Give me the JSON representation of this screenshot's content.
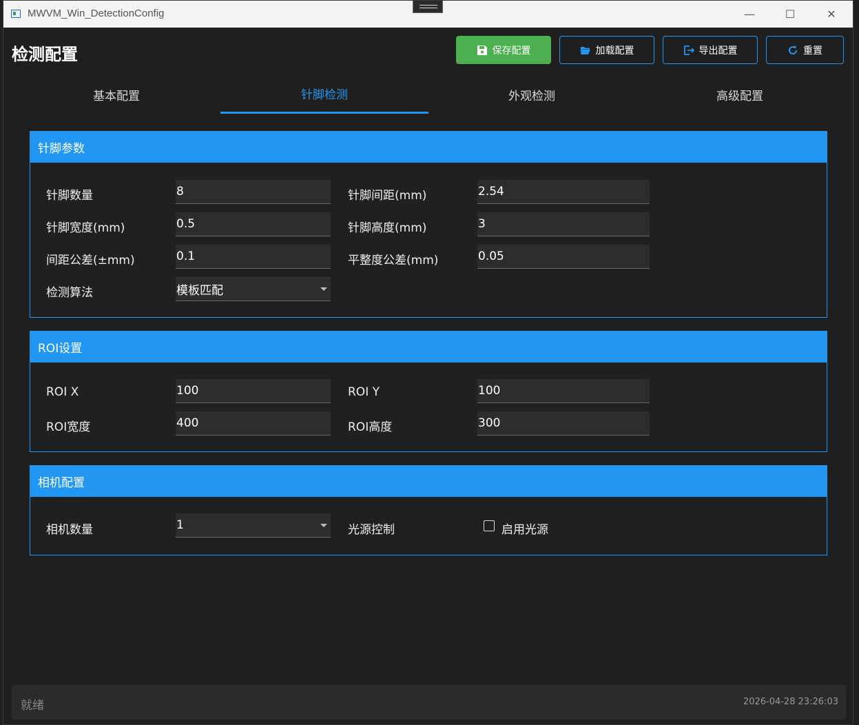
{
  "window": {
    "title": "MWVM_Win_DetectionConfig",
    "minimize_glyph": "—",
    "maximize_glyph": "☐",
    "close_glyph": "✕"
  },
  "header": {
    "title": "检测配置",
    "buttons": {
      "save": {
        "label": "保存配置",
        "icon": "save-icon",
        "color": "#4caf50"
      },
      "load": {
        "label": "加载配置",
        "icon": "folder-open-icon"
      },
      "export": {
        "label": "导出配置",
        "icon": "export-icon"
      },
      "reset": {
        "label": "重置",
        "icon": "refresh-icon"
      }
    }
  },
  "tabs": [
    {
      "label": "基本配置",
      "active": false
    },
    {
      "label": "针脚检测",
      "active": true
    },
    {
      "label": "外观检测",
      "active": false
    },
    {
      "label": "高级配置",
      "active": false
    }
  ],
  "accent_color": "#2196f3",
  "panels": {
    "pin": {
      "title": "针脚参数",
      "pin_count": {
        "label": "针脚数量",
        "value": "8"
      },
      "pin_pitch": {
        "label": "针脚间距(mm)",
        "value": "2.54"
      },
      "pin_width": {
        "label": "针脚宽度(mm)",
        "value": "0.5"
      },
      "pin_height": {
        "label": "针脚高度(mm)",
        "value": "3"
      },
      "pitch_tol": {
        "label": "间距公差(±mm)",
        "value": "0.1"
      },
      "flatness_tol": {
        "label": "平整度公差(mm)",
        "value": "0.05"
      },
      "algorithm": {
        "label": "检测算法",
        "value": "模板匹配"
      }
    },
    "roi": {
      "title": "ROI设置",
      "roi_x": {
        "label": "ROI X",
        "value": "100"
      },
      "roi_y": {
        "label": "ROI Y",
        "value": "100"
      },
      "roi_w": {
        "label": "ROI宽度",
        "value": "400"
      },
      "roi_h": {
        "label": "ROI高度",
        "value": "300"
      }
    },
    "camera": {
      "title": "相机配置",
      "camera_count": {
        "label": "相机数量",
        "value": "1"
      },
      "light": {
        "label": "光源控制",
        "checkbox_label": "启用光源",
        "checked": false
      }
    }
  },
  "status": {
    "text": "就绪",
    "timestamp": "2026-04-28 23:26:03"
  }
}
